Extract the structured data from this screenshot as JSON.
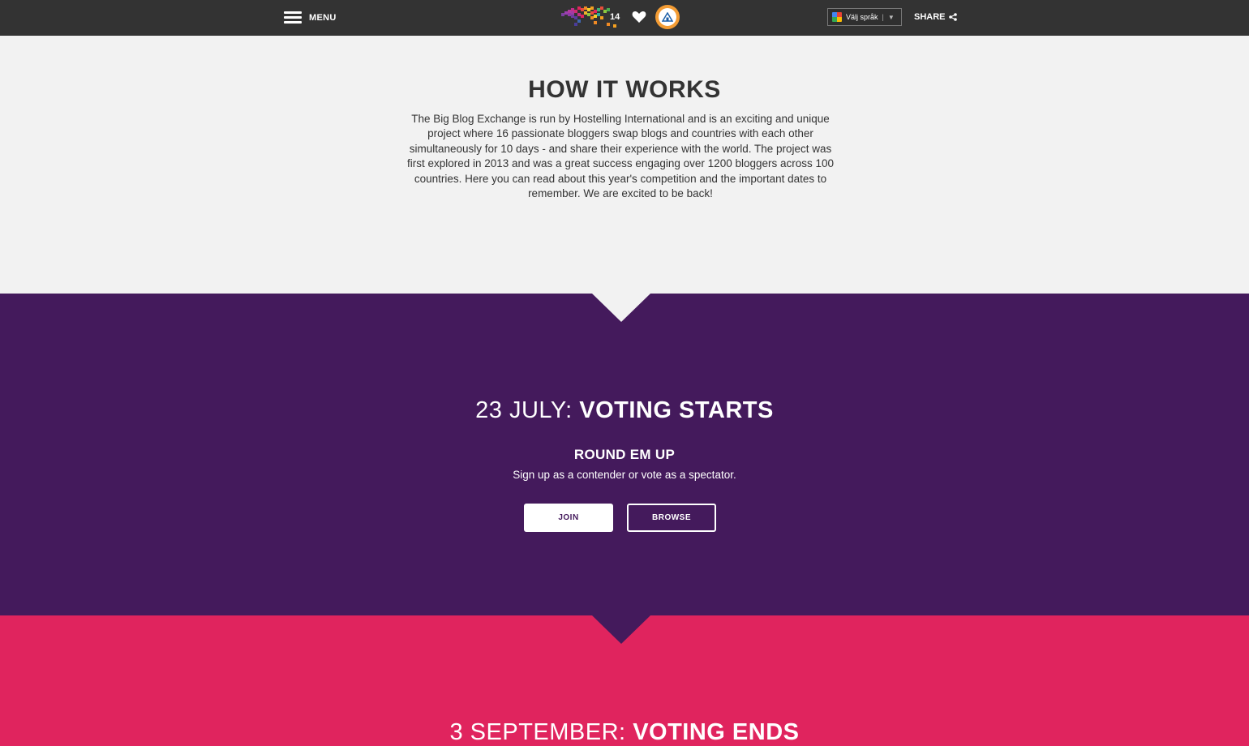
{
  "header": {
    "menu_label": "MENU",
    "logo_number": "14",
    "language_select": "Välj språk",
    "language_separator": "|",
    "share_label": "SHARE"
  },
  "how_it_works": {
    "title": "HOW IT WORKS",
    "body": "The Big Blog Exchange is run by Hostelling International and is an exciting and unique project where 16 passionate bloggers swap blogs and countries with each other simultaneously for 10 days - and share their experience with the world. The project was first explored in 2013 and was a great success engaging over 1200 bloggers across 100 countries. Here you can read about this year's competition and the important dates to remember. We are excited to be back!"
  },
  "voting_starts": {
    "date": "23 JULY:",
    "title": "VOTING STARTS",
    "subheading": "ROUND EM UP",
    "text": "Sign up as a contender or vote as a spectator.",
    "join_label": "JOIN",
    "browse_label": "BROWSE"
  },
  "voting_ends": {
    "date": "3 SEPTEMBER:",
    "title": "VOTING ENDS"
  },
  "colors": {
    "topbar": "#333333",
    "purple": "#441a5c",
    "pink": "#e0245e",
    "background": "#f2f2f2"
  }
}
